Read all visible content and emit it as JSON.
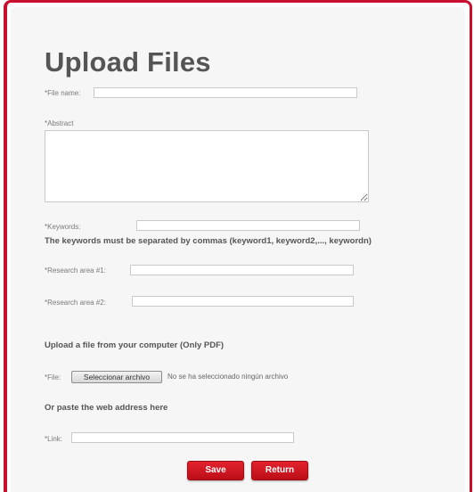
{
  "form": {
    "title": "Upload Files",
    "file_name_label": "*File name:",
    "file_name_value": "",
    "abstract_label": "*Abstract",
    "abstract_value": "",
    "keywords_label": "*Keywords:",
    "keywords_value": "",
    "keywords_note": "The keywords must be separated by commas (keyword1, keyword2,..., keywordn)",
    "research_area_1_label": "*Research area #1:",
    "research_area_1_value": "",
    "research_area_2_label": "*Research area #2:",
    "research_area_2_value": "",
    "upload_heading": "Upload a file from your computer (Only PDF)",
    "file_label": "*File:",
    "file_button_label": "Seleccionar archivo",
    "file_status": "No se ha seleccionado ningún archivo",
    "paste_heading": "Or paste the web address here",
    "link_label": "*Link:",
    "link_value": "",
    "save_label": "Save",
    "return_label": "Return"
  },
  "colors": {
    "accent": "#c8102e",
    "button_red": "#d11a24"
  }
}
